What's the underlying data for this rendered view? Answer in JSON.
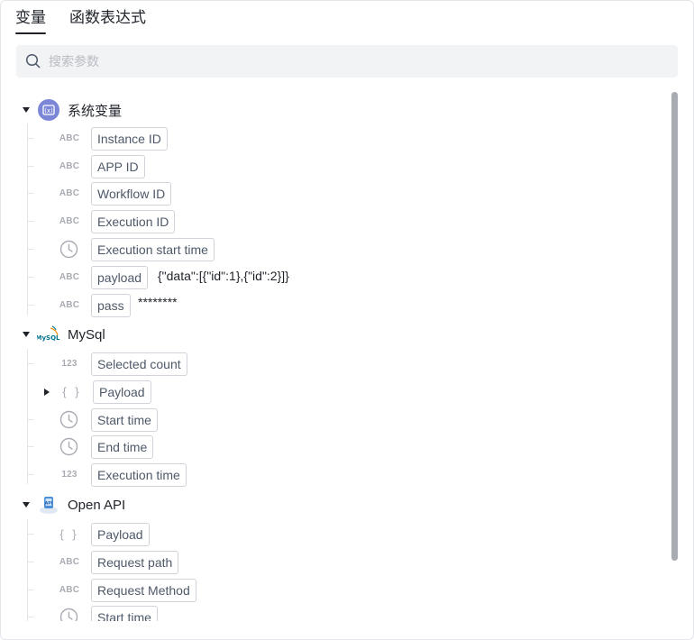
{
  "tabs": [
    {
      "label": "变量",
      "active": true
    },
    {
      "label": "函数表达式",
      "active": false
    }
  ],
  "search": {
    "placeholder": "搜索参数"
  },
  "groups": [
    {
      "title": "系统变量",
      "icon": "system-variable-icon",
      "items": [
        {
          "type": "ABC",
          "label": "Instance ID"
        },
        {
          "type": "ABC",
          "label": "APP ID"
        },
        {
          "type": "ABC",
          "label": "Workflow ID"
        },
        {
          "type": "ABC",
          "label": "Execution ID"
        },
        {
          "type": "time",
          "label": "Execution start time"
        },
        {
          "type": "ABC",
          "label": "payload",
          "value": "{\"data\":[{\"id\":1},{\"id\":2}]}"
        },
        {
          "type": "ABC",
          "label": "pass",
          "value": "********"
        }
      ]
    },
    {
      "title": "MySql",
      "icon": "mysql-logo-icon",
      "logo_text": "MySQL",
      "items": [
        {
          "type": "123",
          "label": "Selected count"
        },
        {
          "type": "{ }",
          "label": "Payload",
          "expandable": true
        },
        {
          "type": "time",
          "label": "Start time"
        },
        {
          "type": "time",
          "label": "End time"
        },
        {
          "type": "123",
          "label": "Execution time"
        }
      ]
    },
    {
      "title": "Open API",
      "icon": "open-api-icon",
      "logo_text": "API",
      "items": [
        {
          "type": "{ }",
          "label": "Payload"
        },
        {
          "type": "ABC",
          "label": "Request path"
        },
        {
          "type": "ABC",
          "label": "Request Method"
        },
        {
          "type": "time",
          "label": "Start time"
        }
      ]
    }
  ],
  "colors": {
    "accent": "#7b86d6",
    "mysql_blue": "#00758f",
    "mysql_orange": "#f29111",
    "api_blue": "#4a8fd8"
  }
}
